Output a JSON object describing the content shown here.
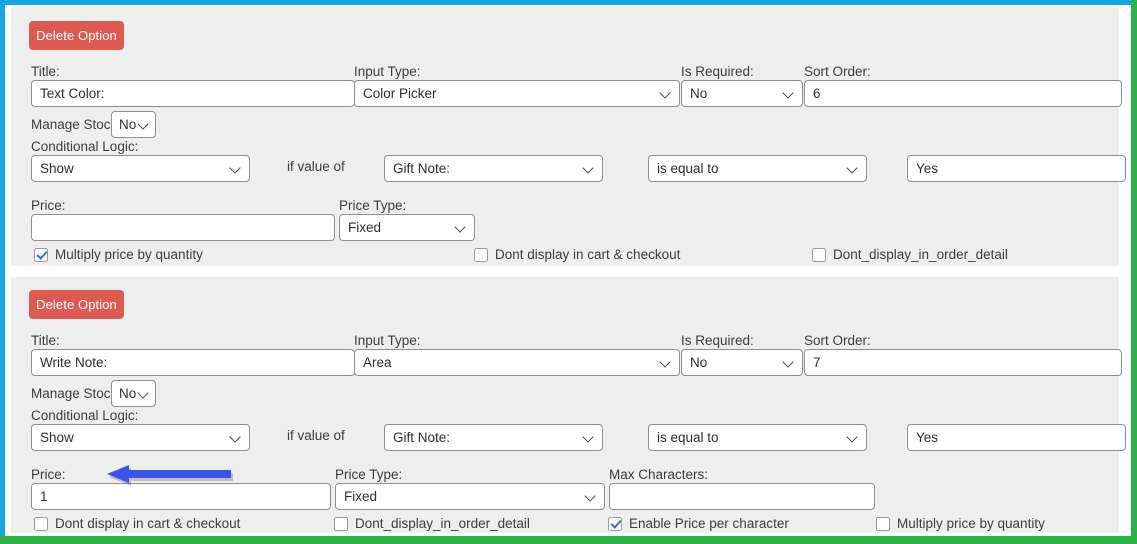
{
  "frame": {
    "accent_top_left": "#16a5e0",
    "accent_right_bottom": "#2db24a"
  },
  "annotation": {
    "arrow": {
      "name": "left-pointing-arrow",
      "color": "#3a54e8",
      "direction": "left",
      "points_at": "Price: field of second option"
    }
  },
  "options": [
    {
      "delete_label": "Delete Option",
      "title": {
        "label": "Title:",
        "value": "Text Color:"
      },
      "input_type": {
        "label": "Input Type:",
        "value": "Color Picker"
      },
      "is_required": {
        "label": "Is Required:",
        "value": "No"
      },
      "sort_order": {
        "label": "Sort Order:",
        "value": "6"
      },
      "manage_stock": {
        "label": "Manage Stock",
        "value": "No"
      },
      "conditional_logic": {
        "label": "Conditional Logic:",
        "action": "Show",
        "connector": "if value of",
        "field": "Gift Note:",
        "operator": "is equal to",
        "value": "Yes"
      },
      "price": {
        "label": "Price:",
        "value": ""
      },
      "price_type": {
        "label": "Price Type:",
        "value": "Fixed"
      },
      "checkboxes": [
        {
          "label": "Multiply price by quantity",
          "checked": true
        },
        {
          "label": "Dont display in cart & checkout",
          "checked": false
        },
        {
          "label": "Dont_display_in_order_detail",
          "checked": false
        }
      ]
    },
    {
      "delete_label": "Delete Option",
      "title": {
        "label": "Title:",
        "value": "Write Note:"
      },
      "input_type": {
        "label": "Input Type:",
        "value": "Area"
      },
      "is_required": {
        "label": "Is Required:",
        "value": "No"
      },
      "sort_order": {
        "label": "Sort Order:",
        "value": "7"
      },
      "manage_stock": {
        "label": "Manage Stock",
        "value": "No"
      },
      "conditional_logic": {
        "label": "Conditional Logic:",
        "action": "Show",
        "connector": "if value of",
        "field": "Gift Note:",
        "operator": "is equal to",
        "value": "Yes"
      },
      "price": {
        "label": "Price:",
        "value": "1"
      },
      "price_type": {
        "label": "Price Type:",
        "value": "Fixed"
      },
      "max_characters": {
        "label": "Max Characters:",
        "value": ""
      },
      "checkboxes": [
        {
          "label": "Dont display in cart & checkout",
          "checked": false
        },
        {
          "label": "Dont_display_in_order_detail",
          "checked": false
        },
        {
          "label": "Enable Price per character",
          "checked": true
        },
        {
          "label": "Multiply price by quantity",
          "checked": false
        }
      ]
    }
  ]
}
